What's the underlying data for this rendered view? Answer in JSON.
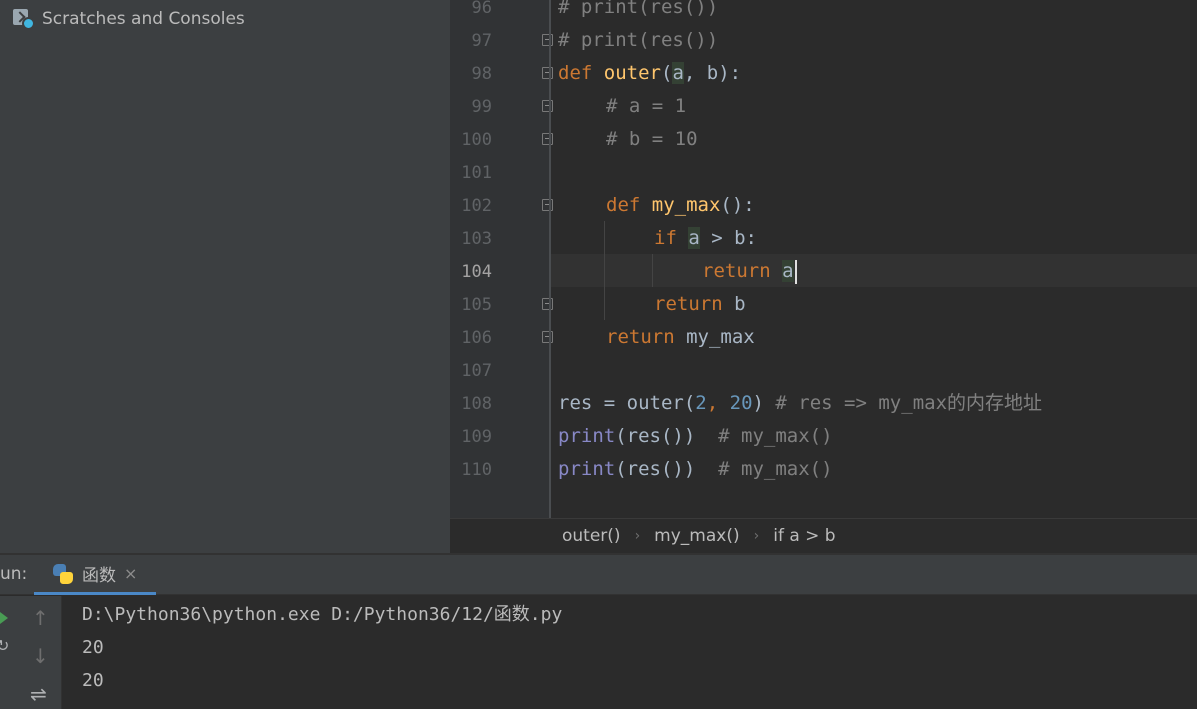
{
  "sidebar": {
    "scratches_label": "Scratches and Consoles",
    "scratches_icon": "scratches-icon"
  },
  "editor": {
    "line_numbers": [
      "96",
      "97",
      "98",
      "99",
      "100",
      "101",
      "102",
      "103",
      "104",
      "105",
      "106",
      "107",
      "108",
      "109",
      "110"
    ],
    "current_line": "104",
    "code": {
      "l96": "# print(res())",
      "l97": "# print(res())",
      "l98_def": "def",
      "l98_name": "outer",
      "l98_open": "(",
      "l98_a": "a",
      "l98_rest": ", b):",
      "l99": "# a = 1",
      "l100": "# b = 10",
      "l102_def": "def",
      "l102_name": "my_max",
      "l102_rest": "():",
      "l103_if": "if",
      "l103_a": "a",
      "l103_rest": " > b:",
      "l104_return": "return",
      "l104_a": "a",
      "l105_return": "return",
      "l105_rest": " b",
      "l106_return": "return",
      "l106_rest": " my_max",
      "l108_lhs": "res = outer(",
      "l108_n1": "2",
      "l108_comma": ", ",
      "l108_n2": "20",
      "l108_close": ")",
      "l108_comment": "# res => my_max的内存地址",
      "l109_print": "print",
      "l109_call": "(res())",
      "l109_comment": "# my_max()",
      "l110_print": "print",
      "l110_call": "(res())",
      "l110_comment": "# my_max()"
    }
  },
  "breadcrumb": {
    "items": [
      "outer()",
      "my_max()",
      "if a > b"
    ]
  },
  "run": {
    "label": "un:",
    "tab_name": "函数",
    "tab_close": "×",
    "console": [
      "D:\\Python36\\python.exe D:/Python36/12/函数.py",
      "20",
      "20"
    ],
    "toolbar_icons": [
      "rerun-icon",
      "up-arrow-icon",
      "down-arrow-icon",
      "wrap-icon"
    ]
  },
  "colors": {
    "keyword": "#cc7832",
    "function": "#ffc66d",
    "builtin": "#8888c6",
    "number": "#6897bb",
    "comment": "#808080",
    "text": "#a9b7c6"
  }
}
